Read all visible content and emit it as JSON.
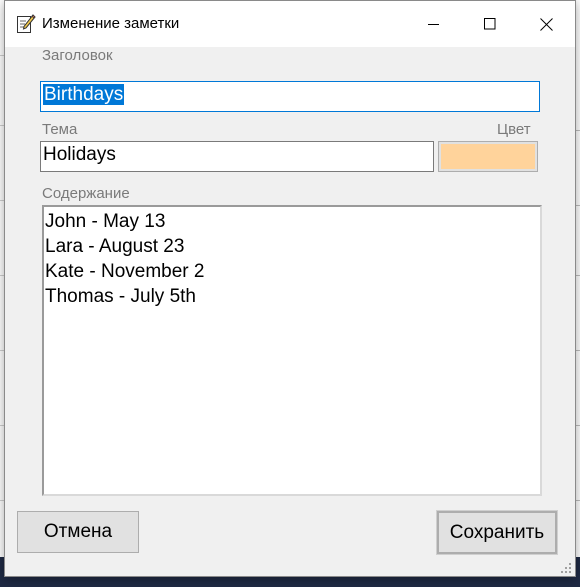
{
  "window": {
    "title": "Изменение заметки",
    "icons": {
      "app": "edit-note-icon",
      "minimize": "minimize-icon",
      "maximize": "maximize-icon",
      "close": "close-icon"
    }
  },
  "form": {
    "title_label": "Заголовок",
    "title_value": "Birthdays",
    "topic_label": "Тема",
    "topic_value": "Holidays",
    "color_label": "Цвет",
    "color_value": "#ffd39b",
    "content_label": "Содержание",
    "content_lines": [
      "John - May 13",
      "Lara - August 23",
      "Kate - November 2",
      "Thomas - July 5th"
    ]
  },
  "buttons": {
    "cancel": "Отмена",
    "save": "Сохранить"
  },
  "accent": "#0078d7"
}
